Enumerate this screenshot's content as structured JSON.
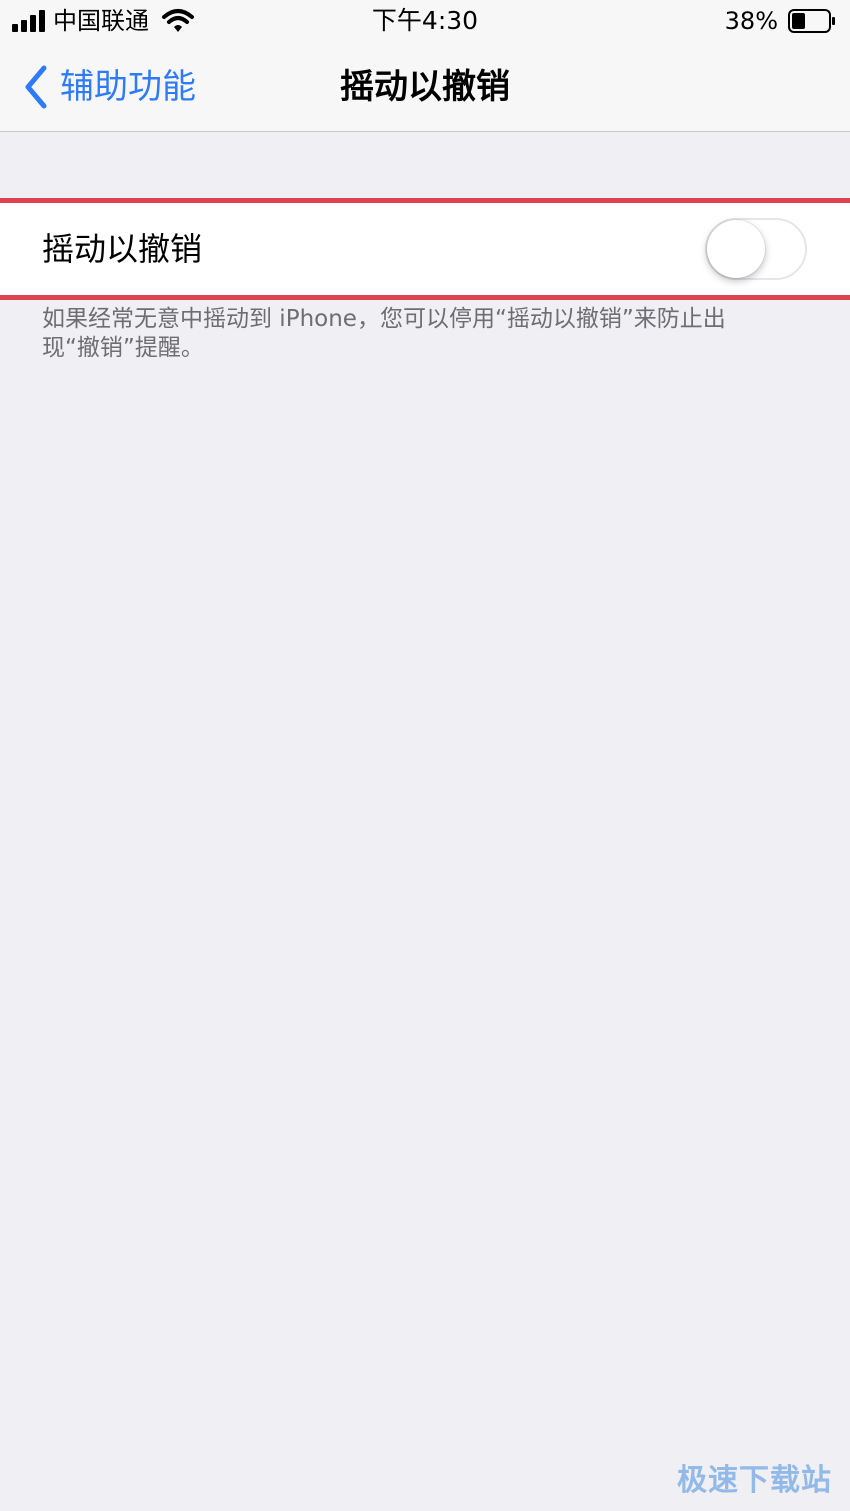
{
  "status_bar": {
    "carrier": "中国联通",
    "time": "下午4:30",
    "battery_percent": "38%",
    "battery_level": 0.38,
    "signal_icon": "signal-bars-icon",
    "wifi_icon": "wifi-icon",
    "battery_icon": "battery-icon"
  },
  "nav": {
    "back_label": "辅助功能",
    "back_icon": "chevron-left-icon",
    "title": "摇动以撤销"
  },
  "setting": {
    "label": "摇动以撤销",
    "enabled": false,
    "description": "如果经常无意中摇动到 iPhone，您可以停用“摇动以撤销”来防止出现“撤销”提醒。"
  },
  "colors": {
    "accent": "#2f7bf5",
    "highlight": "#de4450",
    "background": "#efeff4"
  },
  "watermark": "极速下载站"
}
